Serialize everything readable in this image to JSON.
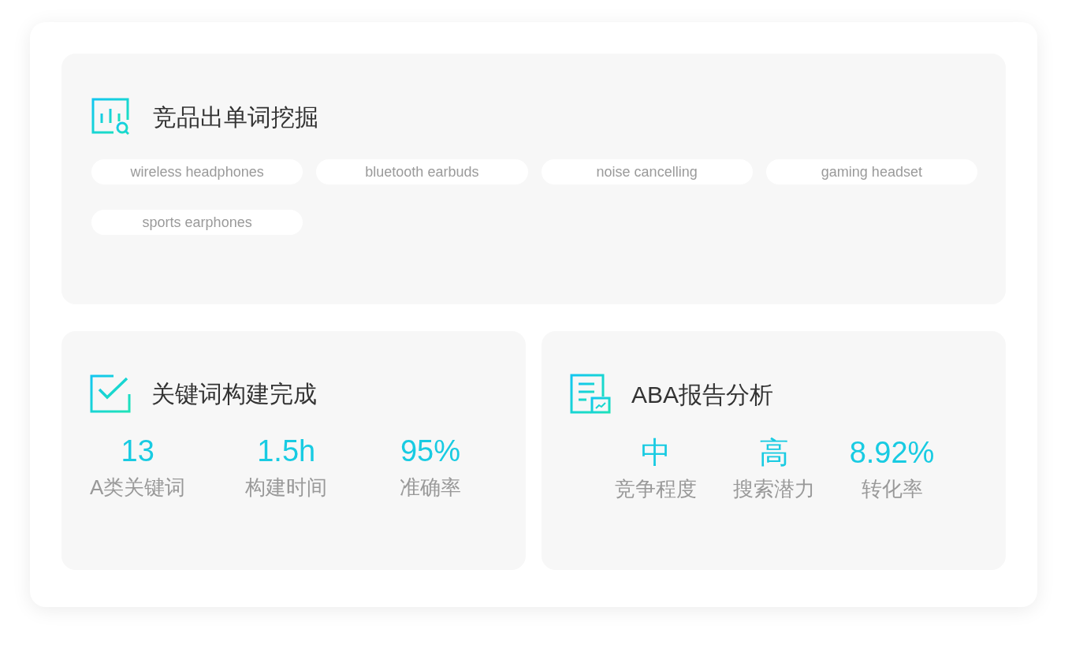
{
  "keyword_mining": {
    "title": "竞品出单词挖掘",
    "tags": [
      "wireless headphones",
      "bluetooth earbuds",
      "noise cancelling",
      "gaming headset",
      "sports earphones"
    ]
  },
  "stat_panels": [
    {
      "title": "关键词构建完成",
      "stats": [
        {
          "value": "13",
          "label": "A类关键词"
        },
        {
          "value": "1.5h",
          "label": "构建时间"
        },
        {
          "value": "95%",
          "label": "准确率"
        }
      ]
    },
    {
      "title": "ABA报告分析",
      "stats": [
        {
          "value": "中",
          "label": "竞争程度"
        },
        {
          "value": "高",
          "label": "搜索潜力"
        },
        {
          "value": "8.92%",
          "label": "转化率"
        }
      ]
    }
  ]
}
